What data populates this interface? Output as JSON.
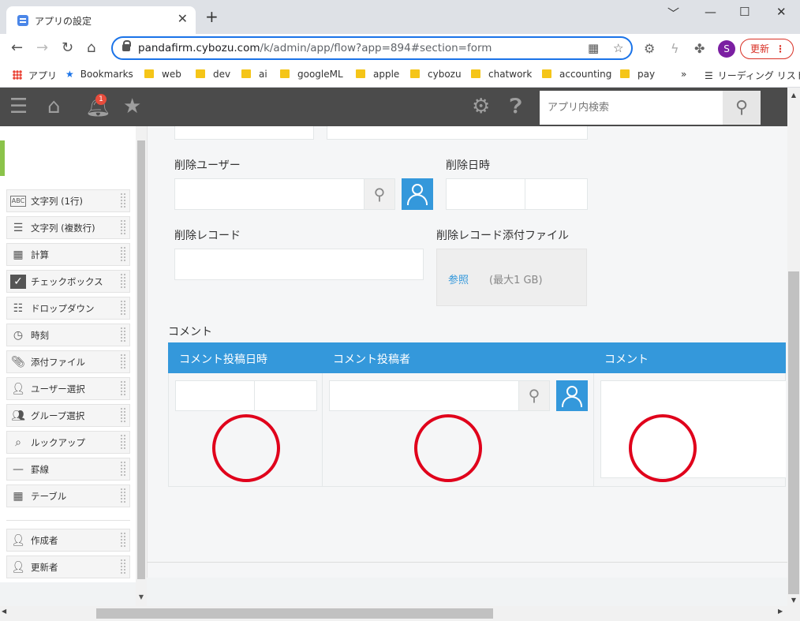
{
  "browser": {
    "tab_title": "アプリの設定",
    "tab_close": "✕",
    "new_tab": "+",
    "window_controls": [
      "﹀",
      "—",
      "☐",
      "✕"
    ],
    "url_host": "pandafirm.cybozu.com",
    "url_path": "/k/admin/app/flow?app=894#section=form",
    "profile_initial": "S",
    "update_label": "更新",
    "bookmarks": [
      {
        "label": "アプリ",
        "icon": "apps-grid-icon"
      },
      {
        "label": "Bookmarks",
        "icon": "star-icon"
      },
      {
        "label": "web",
        "icon": "folder-icon"
      },
      {
        "label": "dev",
        "icon": "folder-icon"
      },
      {
        "label": "ai",
        "icon": "folder-icon"
      },
      {
        "label": "googleML",
        "icon": "folder-icon"
      },
      {
        "label": "apple",
        "icon": "folder-icon"
      },
      {
        "label": "cybozu",
        "icon": "folder-icon"
      },
      {
        "label": "chatwork",
        "icon": "folder-icon"
      },
      {
        "label": "accounting",
        "icon": "folder-icon"
      },
      {
        "label": "pay",
        "icon": "folder-icon"
      }
    ],
    "bookmarks_overflow": "»",
    "reading_list": "リーディング リスト"
  },
  "app_header": {
    "notification_count": "1",
    "search_placeholder": "アプリ内検索"
  },
  "palette": {
    "items": [
      {
        "label": "文字列 (1行)",
        "icon": "abc-icon"
      },
      {
        "label": "文字列 (複数行)",
        "icon": "multiline-text-icon"
      },
      {
        "label": "計算",
        "icon": "calculator-icon"
      },
      {
        "label": "チェックボックス",
        "icon": "checkbox-icon"
      },
      {
        "label": "ドロップダウン",
        "icon": "dropdown-icon"
      },
      {
        "label": "時刻",
        "icon": "clock-icon"
      },
      {
        "label": "添付ファイル",
        "icon": "paperclip-icon"
      },
      {
        "label": "ユーザー選択",
        "icon": "user-icon"
      },
      {
        "label": "グループ選択",
        "icon": "group-icon"
      },
      {
        "label": "ルックアップ",
        "icon": "lookup-icon"
      },
      {
        "label": "罫線",
        "icon": "line-icon"
      },
      {
        "label": "テーブル",
        "icon": "table-icon"
      }
    ],
    "system_items": [
      {
        "label": "作成者",
        "icon": "user-icon"
      },
      {
        "label": "更新者",
        "icon": "user-icon"
      }
    ]
  },
  "form": {
    "delete_user_label": "削除ユーザー",
    "delete_datetime_label": "削除日時",
    "delete_record_label": "削除レコード",
    "delete_attachment_label": "削除レコード添付ファイル",
    "browse_link": "参照",
    "max_size": "(最大1 GB)",
    "comment_table_title": "コメント",
    "comment_columns": [
      "コメント投稿日時",
      "コメント投稿者",
      "コメント"
    ]
  },
  "colors": {
    "accent_blue": "#3498db",
    "header_dark": "#4b4b4b",
    "annotation_red": "#e0001b",
    "palette_accent_green": "#8bc34a"
  }
}
